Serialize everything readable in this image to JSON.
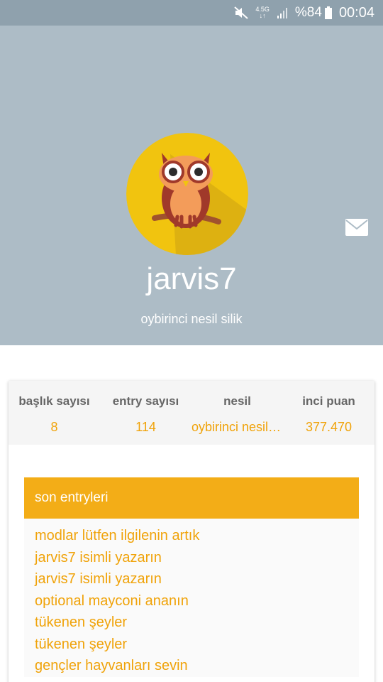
{
  "status_bar": {
    "network": "4.5G",
    "battery": "%84",
    "time": "00:04",
    "icons": [
      "mute-icon",
      "network-arrows-icon",
      "signal-icon",
      "battery-icon"
    ]
  },
  "profile": {
    "username": "jarvis7",
    "tagline": "oybirinci nesil silik",
    "avatar_icon": "owl-avatar",
    "header_color": "#adbcc6"
  },
  "stats": [
    {
      "label": "başlık sayısı",
      "value": "8"
    },
    {
      "label": "entry sayısı",
      "value": "114"
    },
    {
      "label": "nesil",
      "value": "oybirinci nesil silik"
    },
    {
      "label": "inci puan",
      "value": "377.470"
    }
  ],
  "entries_section": {
    "title": "son entryleri",
    "accent_color": "#f3ad17",
    "items": [
      "modlar lütfen ilgilenin artık",
      "jarvis7 isimli yazarın",
      "jarvis7 isimli yazarın",
      "optional mayconi ananın",
      "tükenen şeyler",
      "tükenen şeyler",
      "gençler hayvanları sevin"
    ]
  }
}
